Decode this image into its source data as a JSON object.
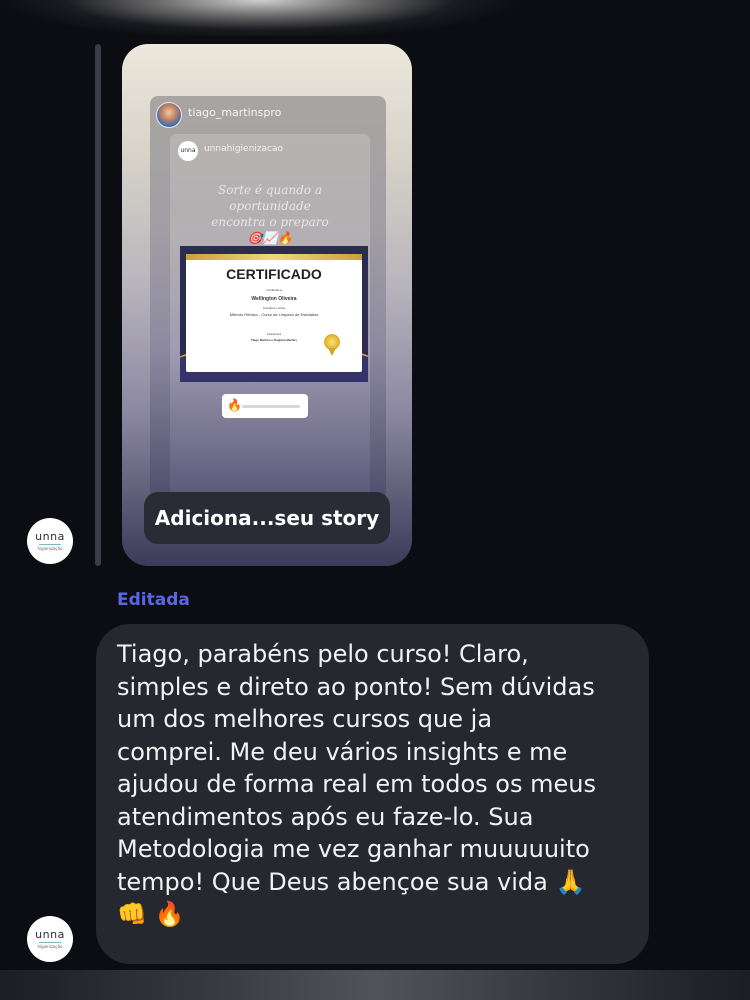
{
  "story": {
    "username": "tiago_martinspro",
    "inner_username": "unnahigienizacao",
    "inner_logo": "unna",
    "caption": "Sorte é quando a oportunidade encontra o preparo 🎯📈🔥",
    "certificate": {
      "title": "CERTIFICADO",
      "conferred": "Conferido a",
      "recipient": "Wellington Oliveira",
      "completion": "Concluiu o curso",
      "course": "Método Rítmico - Curso de Limpeza de Estofados",
      "instructors_label": "Instrutores",
      "instructors": "Tiago Martins e Rogiane Martins"
    },
    "reaction_emoji": "🔥",
    "action_label": "Adiciona...seu story"
  },
  "avatar": {
    "brand": "unna",
    "subtitle": "higienização"
  },
  "message": {
    "edited_label": "Editada",
    "text": "Tiago, parabéns pelo curso! Claro,\nsimples e direto ao ponto! Sem dúvidas\num dos melhores cursos que ja\ncomprei. Me deu vários insights e me\najudou de forma real em todos os meus\natendimentos após eu faze-lo. Sua\nMetodologia me vez ganhar muuuuuito\ntempo! Que Deus abençoe sua vida 🙏\n👊 🔥"
  },
  "colors": {
    "background": "#0b0d13",
    "bubble": "#262830",
    "edited": "#5a66e6"
  }
}
